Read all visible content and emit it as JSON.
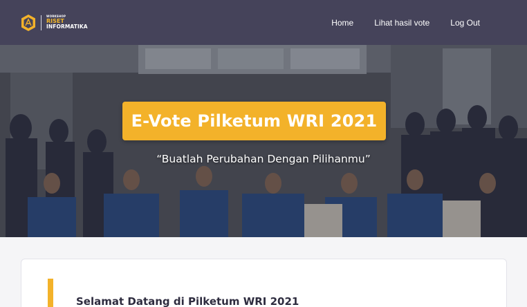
{
  "brand": {
    "small": "WORKSHOP",
    "line1": "RISET",
    "line2": "INFORMATIKA"
  },
  "nav": {
    "items": [
      {
        "label": "Home"
      },
      {
        "label": "Lihat hasil vote"
      },
      {
        "label": "Log Out"
      }
    ]
  },
  "hero": {
    "title": "E-Vote Pilketum WRI 2021",
    "tagline": "“Buatlah Perubahan Dengan Pilihanmu”"
  },
  "welcome": {
    "title": "Selamat Datang di Pilketum WRI 2021"
  },
  "colors": {
    "navbar": "#45435a",
    "accent": "#f3b22a",
    "text_dark": "#2e2c3f"
  }
}
